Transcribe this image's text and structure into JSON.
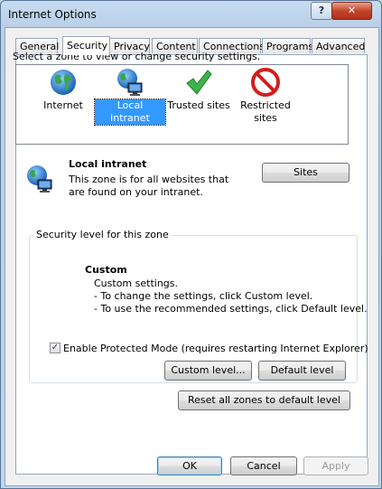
{
  "window": {
    "title": "Internet Options",
    "help_label": "?",
    "close_label": "✕"
  },
  "tabs": [
    {
      "label": "General"
    },
    {
      "label": "Security"
    },
    {
      "label": "Privacy"
    },
    {
      "label": "Content"
    },
    {
      "label": "Connections"
    },
    {
      "label": "Programs"
    },
    {
      "label": "Advanced"
    }
  ],
  "security": {
    "prompt": "Select a zone to view or change security settings.",
    "zones": [
      {
        "label": "Internet",
        "icon": "globe-icon"
      },
      {
        "label": "Local intranet",
        "icon": "intranet-icon",
        "selected": true
      },
      {
        "label": "Trusted sites",
        "icon": "checkmark-icon"
      },
      {
        "label": "Restricted sites",
        "icon": "no-entry-icon"
      }
    ],
    "zone_description": {
      "title": "Local intranet",
      "text": "This zone is for all websites that are found on your intranet."
    },
    "sites_button": "Sites",
    "level_group_label": "Security level for this zone",
    "level": {
      "title": "Custom",
      "line1": "Custom settings.",
      "line2": "- To change the settings, click Custom level.",
      "line3": "- To use the recommended settings, click Default level."
    },
    "protected_mode": {
      "label": "Enable Protected Mode (requires restarting Internet Explorer)",
      "checked": true
    },
    "custom_level_button": "Custom level...",
    "default_level_button": "Default level",
    "reset_button": "Reset all zones to default level"
  },
  "footer": {
    "ok": "OK",
    "cancel": "Cancel",
    "apply": "Apply"
  },
  "colors": {
    "selection": "#3399ff",
    "close_button": "#c4442a",
    "title_bar": "#c7dcf1"
  }
}
